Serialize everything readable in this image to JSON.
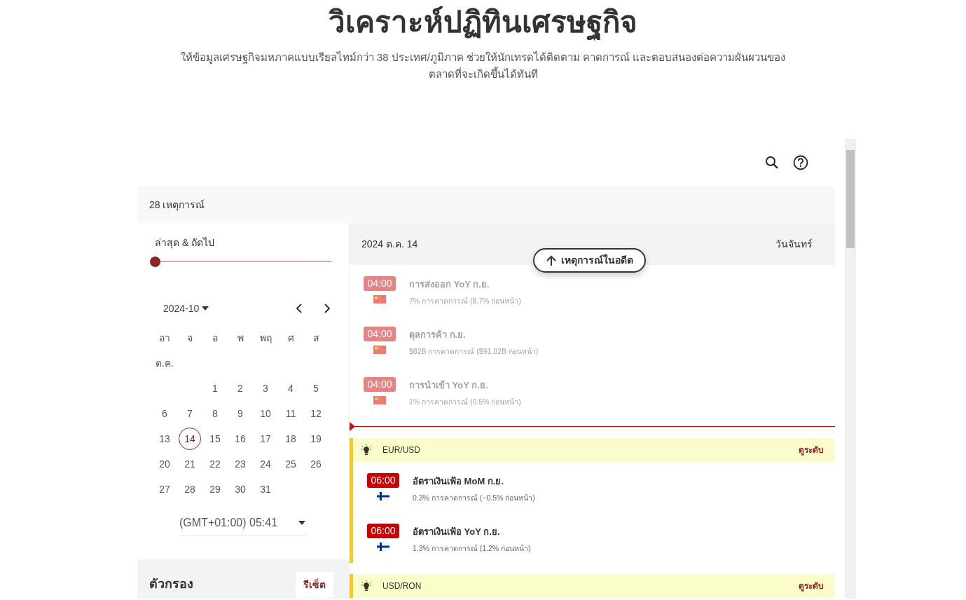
{
  "page": {
    "title": "วิเคราะห์ปฏิทินเศรษฐกิจ",
    "subtitle": "ให้ข้อมูลเศรษฐกิจมหภาคแบบเรียลไทม์กว่า 38 ประเทศ/ภูมิภาค ช่วยให้นักเทรดได้ติดตาม คาดการณ์ และตอบสนองต่อความผันผวนของตลาดที่จะเกิดขึ้นได้ทันที"
  },
  "event_count": "28 เหตุการณ์",
  "sidebar": {
    "range_label": "ล่าสุด & ถัดไป",
    "slider": {
      "level": 0
    },
    "month": "2024-10",
    "weekdays": [
      "อา",
      "จ",
      "อ",
      "พ",
      "พฤ",
      "ศ",
      "ส"
    ],
    "month_label": "ต.ค.",
    "weeks": [
      {
        "kind": "opening",
        "days": [
          {
            "d": "1",
            "selected": false
          },
          {
            "d": "2",
            "selected": false
          },
          {
            "d": "3",
            "selected": false
          },
          {
            "d": "4",
            "selected": false
          },
          {
            "d": "5",
            "selected": false
          }
        ]
      },
      {
        "kind": "full",
        "days": [
          {
            "d": "6",
            "selected": false
          },
          {
            "d": "7",
            "selected": false
          },
          {
            "d": "8",
            "selected": false
          },
          {
            "d": "9",
            "selected": false
          },
          {
            "d": "10",
            "selected": false
          },
          {
            "d": "11",
            "selected": false
          },
          {
            "d": "12",
            "selected": false
          }
        ]
      },
      {
        "kind": "full",
        "days": [
          {
            "d": "13",
            "selected": false
          },
          {
            "d": "14",
            "selected": true
          },
          {
            "d": "15",
            "selected": false
          },
          {
            "d": "16",
            "selected": false
          },
          {
            "d": "17",
            "selected": false
          },
          {
            "d": "18",
            "selected": false
          },
          {
            "d": "19",
            "selected": false
          }
        ]
      },
      {
        "kind": "full",
        "days": [
          {
            "d": "20",
            "selected": false
          },
          {
            "d": "21",
            "selected": false
          },
          {
            "d": "22",
            "selected": false
          },
          {
            "d": "23",
            "selected": false
          },
          {
            "d": "24",
            "selected": false
          },
          {
            "d": "25",
            "selected": false
          },
          {
            "d": "26",
            "selected": false
          }
        ]
      },
      {
        "kind": "closing",
        "days": [
          {
            "d": "27",
            "selected": false
          },
          {
            "d": "28",
            "selected": false
          },
          {
            "d": "29",
            "selected": false
          },
          {
            "d": "30",
            "selected": false
          },
          {
            "d": "31",
            "selected": false
          }
        ]
      }
    ],
    "timezone": "(GMT+01:00) 05:41",
    "filter_title": "ตัวกรอง",
    "reset": "รีเซ็ต"
  },
  "day_header": {
    "date": "2024 ต.ค. 14",
    "weekday": "วันจันทร์"
  },
  "past_button": "เหตุการณ์ในอดีต",
  "past_events": [
    {
      "time": "04:00",
      "kind": "china",
      "title": "การส่งออก YoY ก.ย.",
      "detail": "7% การคาดการณ์ (8.7% ก่อนหน้า)",
      "past": true
    },
    {
      "time": "04:00",
      "kind": "china",
      "title": "ดุลการค้า ก.ย.",
      "detail": "$82B การคาดการณ์ ($91.02B ก่อนหน้า)",
      "past": true
    },
    {
      "time": "04:00",
      "kind": "china",
      "title": "การนำเข้า YoY ก.ย.",
      "detail": "1% การคาดการณ์ (0.5% ก่อนหน้า)",
      "past": true
    }
  ],
  "groups": [
    {
      "pair": "EUR/USD",
      "link": "ดูระดับ",
      "events": [
        {
          "time": "06:00",
          "kind": "finland",
          "title": "อัตราเงินเฟ้อ MoM ก.ย.",
          "detail": "0.3% การคาดการณ์ (−0.5% ก่อนหน้า)",
          "past": false
        },
        {
          "time": "06:00",
          "kind": "finland",
          "title": "อัตราเงินเฟ้อ YoY ก.ย.",
          "detail": "1.3% การคาดการณ์ (1.2% ก่อนหน้า)",
          "past": false
        }
      ]
    },
    {
      "pair": "USD/RON",
      "link": "ดูระดับ"
    }
  ]
}
